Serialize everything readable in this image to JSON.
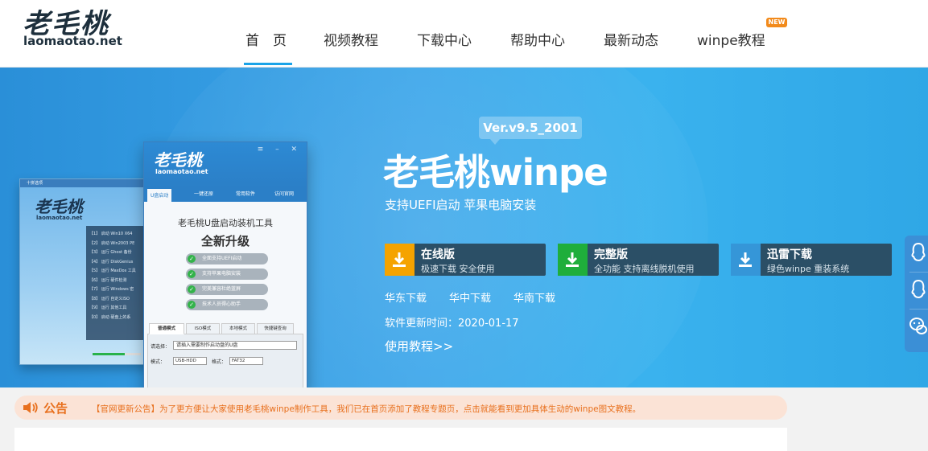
{
  "header": {
    "logo_cn": "老毛桃",
    "logo_en": "laomaotao.net",
    "nav": [
      {
        "label": "首　页",
        "active": true
      },
      {
        "label": "视频教程"
      },
      {
        "label": "下载中心"
      },
      {
        "label": "帮助中心"
      },
      {
        "label": "最新动态"
      },
      {
        "label": "winpe教程",
        "badge": "NEW"
      }
    ]
  },
  "banner": {
    "product_window": {
      "logo_cn": "老毛桃",
      "logo_en": "laomaotao.net",
      "tabs": [
        "U盘启动",
        "一键还原",
        "常用软件",
        "访问官网"
      ],
      "title": "老毛桃U盘启动装机工具",
      "headline": "全新升级",
      "features": [
        "全面支持UEFI启动",
        "支持苹果电脑安装",
        "完美兼容杜绝蓝屏",
        "技术人员得心助手"
      ],
      "modes": [
        "普通模式",
        "ISO模式",
        "本地模式",
        "快捷键查询"
      ],
      "select_label": "请选择：",
      "select_value": "请插入需要制作启动盘的U盘",
      "mode_label": "模式：",
      "mode_value": "USB-HDD",
      "format_label": "格式：",
      "format_value": "FAT32"
    },
    "back_window": {
      "title": "十拼选项",
      "logo_cn": "老毛桃",
      "logo_en": "laomaotao.net",
      "menu": [
        "【1】 启动 Win10 X64",
        "【2】 启动 Win2003 PE",
        "【3】 运行 Ghost 备份",
        "【4】 运行 DiskGenius",
        "【5】 运行 MaxDos 工具",
        "【6】 运行 硬件检测",
        "【7】 运行 Windows 密",
        "【8】 运行 自定义ISO",
        "【9】 运行 其他工具",
        "【0】 启动 硬盘上的系"
      ]
    },
    "version": "Ver.v9.5_2001",
    "title": "老毛桃winpe",
    "subtitle": "支持UEFI启动 苹果电脑安装",
    "downloads": [
      {
        "title": "在线版",
        "desc": "极速下载 安全使用",
        "icon": "download-icon",
        "color": "#f5a300"
      },
      {
        "title": "完整版",
        "desc": "全功能 支持离线脱机使用",
        "icon": "download-icon",
        "color": "#1fae3b"
      },
      {
        "title": "迅雷下载",
        "desc": "绿色winpe 重装系统",
        "icon": "download-icon",
        "color": "#3596d8"
      }
    ],
    "mirrors": [
      "华东下载",
      "华中下载",
      "华南下载"
    ],
    "updated": "软件更新时间：2020-01-17",
    "tutorial": "使用教程>>"
  },
  "notice": {
    "title": "公告",
    "message": "【官网更新公告】为了更方便让大家使用老毛桃winpe制作工具，我们已在首页添加了教程专题页，点击就能看到更加具体生动的winpe图文教程。"
  }
}
